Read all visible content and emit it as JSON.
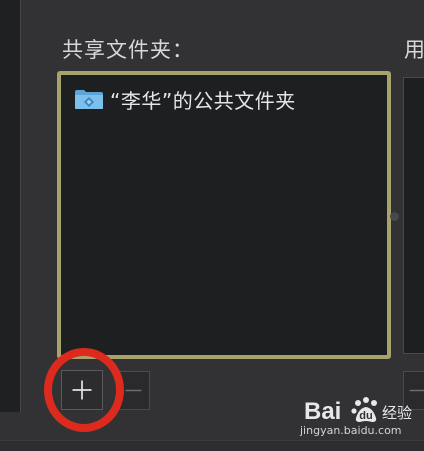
{
  "shared_folders": {
    "title": "共享文件夹：",
    "items": [
      {
        "label": "“李华”的公共文件夹",
        "icon": "shared-folder-icon"
      }
    ],
    "add_button_icon": "plus-icon",
    "remove_button_icon": "minus-icon",
    "highlight_color": "#dc2a1e",
    "selection_border_color": "#a8a36c"
  },
  "users": {
    "title": "用"
  },
  "watermark": {
    "brand": "Bai",
    "brand_suffix": "经验",
    "url": "jingyan.baidu.com"
  }
}
